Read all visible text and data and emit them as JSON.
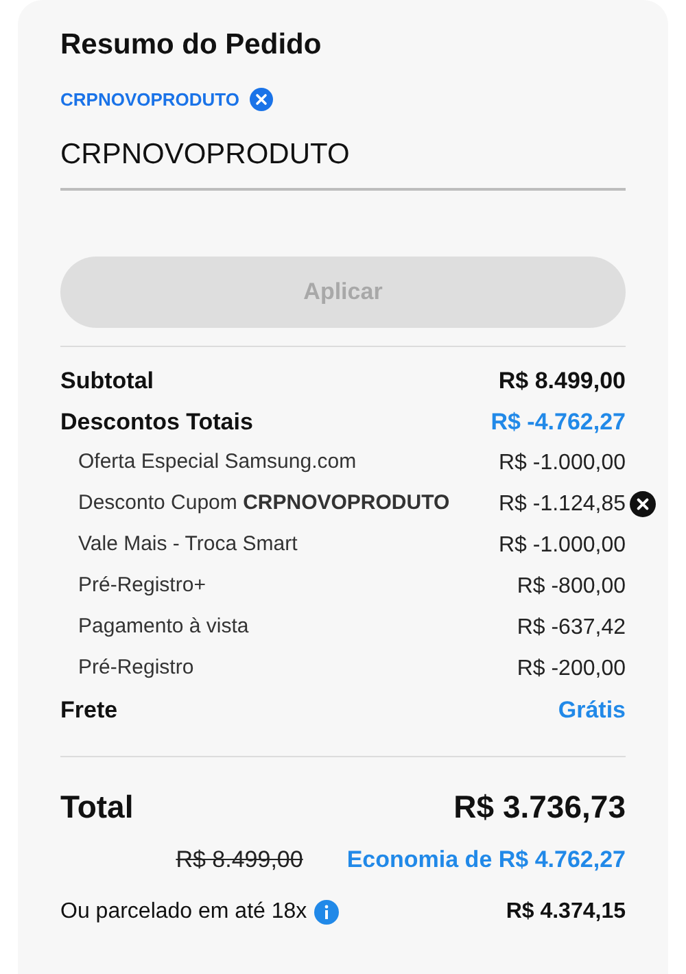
{
  "title": "Resumo do Pedido",
  "coupon_tag": {
    "code": "CRPNOVOPRODUTO"
  },
  "coupon_input": {
    "value": "CRPNOVOPRODUTO"
  },
  "apply_button": {
    "label": "Aplicar",
    "disabled": true
  },
  "subtotal": {
    "label": "Subtotal",
    "value": "R$ 8.499,00"
  },
  "discounts": {
    "label": "Descontos Totais",
    "value": "R$ -4.762,27",
    "items": [
      {
        "label": "Oferta Especial Samsung.com",
        "value": "R$ -1.000,00",
        "removable": false
      },
      {
        "label": "Desconto Cupom **CRPNOVOPRODUTO**",
        "value": "R$ -1.124,85",
        "removable": true
      },
      {
        "label": "Vale Mais - Troca Smart",
        "value": "R$ -1.000,00",
        "removable": false
      },
      {
        "label": "Pré-Registro+",
        "value": "R$ -800,00",
        "removable": false
      },
      {
        "label": "Pagamento à vista",
        "value": "R$ -637,42",
        "removable": false
      },
      {
        "label": "Pré-Registro",
        "value": "R$ -200,00",
        "removable": false
      }
    ]
  },
  "shipping": {
    "label": "Frete",
    "value": "Grátis"
  },
  "total": {
    "label": "Total",
    "value": "R$ 3.736,73"
  },
  "original_price": "R$ 8.499,00",
  "savings": "Economia de R$ 4.762,27",
  "installments": {
    "label": "Ou parcelado em até 18x",
    "value": "R$ 4.374,15"
  }
}
